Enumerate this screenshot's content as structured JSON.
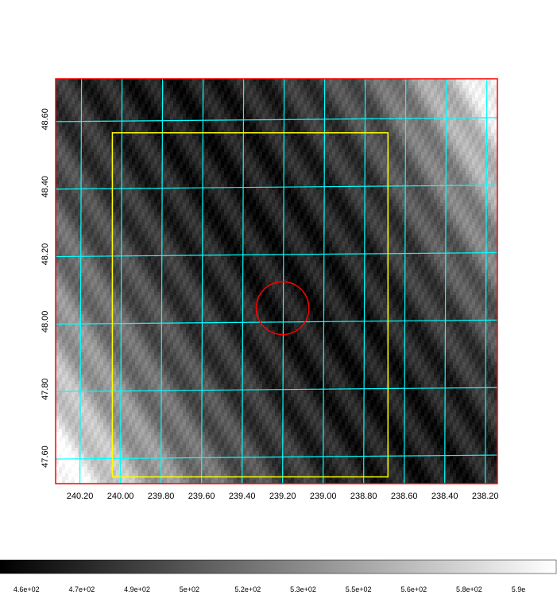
{
  "chart_data": {
    "type": "heatmap",
    "title": "",
    "xlabel": "",
    "ylabel": "",
    "x_tick_labels": [
      "240.20",
      "240.00",
      "239.80",
      "239.60",
      "239.40",
      "239.20",
      "239.00",
      "238.80",
      "238.60",
      "238.40",
      "238.20"
    ],
    "y_tick_labels": [
      "47.60",
      "47.80",
      "48.00",
      "48.20",
      "48.40",
      "48.60"
    ],
    "xlim": [
      240.32,
      238.14
    ],
    "ylim": [
      47.52,
      48.72
    ],
    "grid": true,
    "colormap": "grayscale",
    "colorbar": {
      "placement": "bottom",
      "range": [
        440,
        590
      ],
      "tick_labels": [
        "4.6e+02",
        "4.7e+02",
        "4.9e+02",
        "5e+02",
        "5.2e+02",
        "5.3e+02",
        "5.5e+02",
        "5.6e+02",
        "5.8e+02",
        "5.9e"
      ]
    },
    "overlays": {
      "circle": {
        "ra_center": 239.2,
        "dec_center": 48.04,
        "radius_deg": 0.13,
        "color": "#ff0000"
      },
      "box": {
        "ra_range": [
          240.04,
          238.68
        ],
        "dec_range": [
          47.54,
          48.56
        ],
        "color": "#ffff00"
      },
      "frame_color": "#ff0000",
      "grid_color": "#00ffff"
    }
  }
}
